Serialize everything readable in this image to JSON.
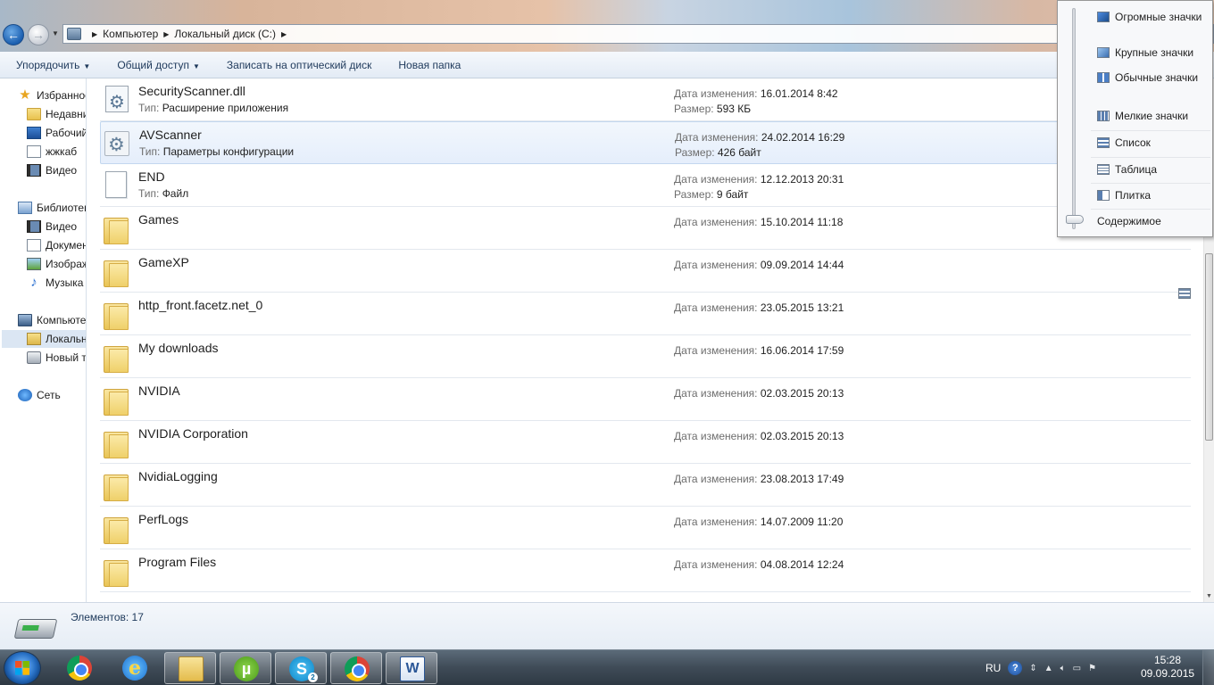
{
  "breadcrumb": [
    "Компьютер",
    "Локальный диск (C:)"
  ],
  "command_bar": {
    "organize": "Упорядочить",
    "share": "Общий доступ",
    "burn": "Записать на оптический диск",
    "new_folder": "Новая папка"
  },
  "sidebar": {
    "favorites": "Избранное",
    "recent": "Недавние места",
    "desktop": "Рабочий стол",
    "custom": "жжкаб",
    "video_fav": "Видео",
    "libraries": "Библиотеки",
    "lib_video": "Видео",
    "lib_docs": "Документы",
    "lib_pics": "Изображения",
    "lib_music": "Музыка",
    "computer": "Компьютер",
    "local_disk": "Локальный диск (C:)",
    "new_volume": "Новый том",
    "network": "Сеть"
  },
  "labels": {
    "modified": "Дата изменения:",
    "type": "Тип:",
    "size": "Размер:"
  },
  "files": [
    {
      "name": "SecurityScanner.dll",
      "type": "Расширение приложения",
      "modified": "16.01.2014 8:42",
      "size": "593 КБ",
      "icon": "dll-file-icon"
    },
    {
      "name": "AVScanner",
      "type": "Параметры конфигурации",
      "modified": "24.02.2014 16:29",
      "size": "426 байт",
      "icon": "config-file-icon"
    },
    {
      "name": "END",
      "type": "Файл",
      "modified": "12.12.2013 20:31",
      "size": "9 байт",
      "icon": "file-icon"
    },
    {
      "name": "Games",
      "modified": "15.10.2014 11:18",
      "icon": "folder-icon"
    },
    {
      "name": "GameXP",
      "modified": "09.09.2014 14:44",
      "icon": "folder-icon"
    },
    {
      "name": "http_front.facetz.net_0",
      "modified": "23.05.2015 13:21",
      "icon": "folder-icon"
    },
    {
      "name": "My downloads",
      "modified": "16.06.2014 17:59",
      "icon": "folder-icon"
    },
    {
      "name": "NVIDIA",
      "modified": "02.03.2015 20:13",
      "icon": "folder-icon"
    },
    {
      "name": "NVIDIA Corporation",
      "modified": "02.03.2015 20:13",
      "icon": "folder-icon"
    },
    {
      "name": "NvidiaLogging",
      "modified": "23.08.2013 17:49",
      "icon": "folder-icon"
    },
    {
      "name": "PerfLogs",
      "modified": "14.07.2009 11:20",
      "icon": "folder-icon"
    },
    {
      "name": "Program Files",
      "modified": "04.08.2014 12:24",
      "icon": "folder-icon"
    }
  ],
  "view_menu": {
    "huge": "Огромные значки",
    "large": "Крупные значки",
    "normal": "Обычные значки",
    "small": "Мелкие значки",
    "list": "Список",
    "table": "Таблица",
    "tiles": "Плитка",
    "content": "Содержимое"
  },
  "details": {
    "item_count": "Элементов: 17"
  },
  "taskbar": {
    "language": "RU",
    "time": "15:28",
    "date": "09.09.2015",
    "skype_badge": "2",
    "apps": [
      "chrome-icon",
      "internet-explorer-icon",
      "explorer-icon",
      "utorrent-icon",
      "skype-icon",
      "chrome-icon",
      "word-icon"
    ]
  }
}
